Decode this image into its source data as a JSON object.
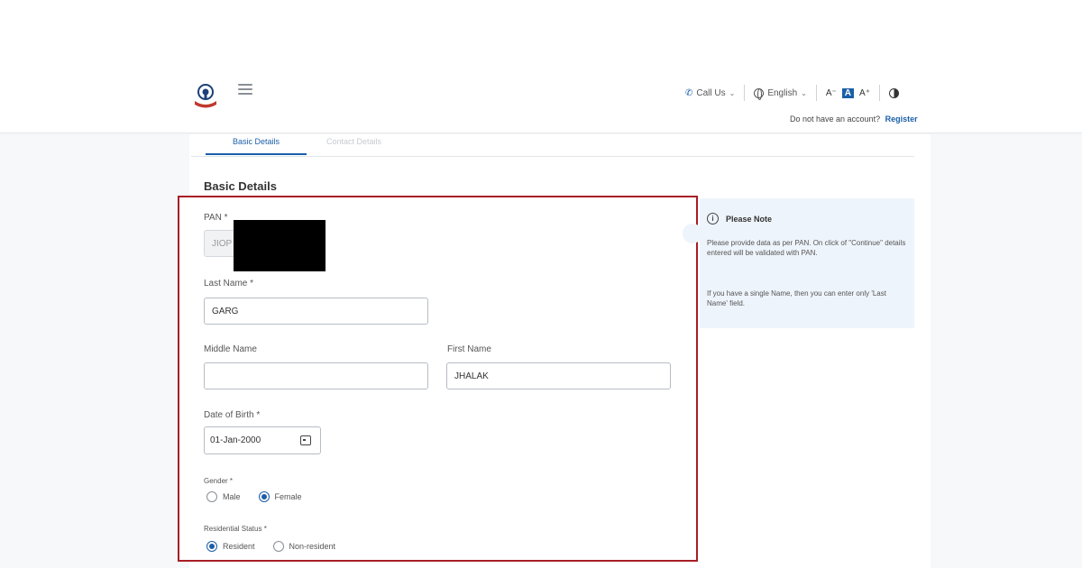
{
  "header": {
    "call_us": "Call Us",
    "language": "English",
    "font_small": "A⁻",
    "font_normal": "A",
    "font_large": "A⁺",
    "account_prompt": "Do not have an account?",
    "register_link": "Register"
  },
  "tabs": [
    {
      "label": "Basic Details",
      "active": true
    },
    {
      "label": "Contact Details",
      "active": false
    }
  ],
  "section_title": "Basic Details",
  "form": {
    "pan_label": "PAN *",
    "pan_value": "JIOP",
    "last_name_label": "Last Name *",
    "last_name_value": "GARG",
    "middle_name_label": "Middle Name",
    "middle_name_value": "",
    "first_name_label": "First Name",
    "first_name_value": "JHALAK",
    "dob_label": "Date of Birth *",
    "dob_value": "01-Jan-2000",
    "gender_label": "Gender *",
    "gender_options": [
      "Male",
      "Female"
    ],
    "gender_selected": "Female",
    "residential_label": "Residential Status *",
    "residential_options": [
      "Resident",
      "Non-resident"
    ],
    "residential_selected": "Resident"
  },
  "note": {
    "title": "Please Note",
    "para1": "Please provide data as per PAN. On click of \"Continue\" details entered will be validated with PAN.",
    "para2": "If you have a single Name, then you can enter only 'Last Name' field."
  },
  "colors": {
    "accent": "#1b5fa8",
    "highlight_border": "#a81e25",
    "note_bg": "#eef4fb"
  }
}
